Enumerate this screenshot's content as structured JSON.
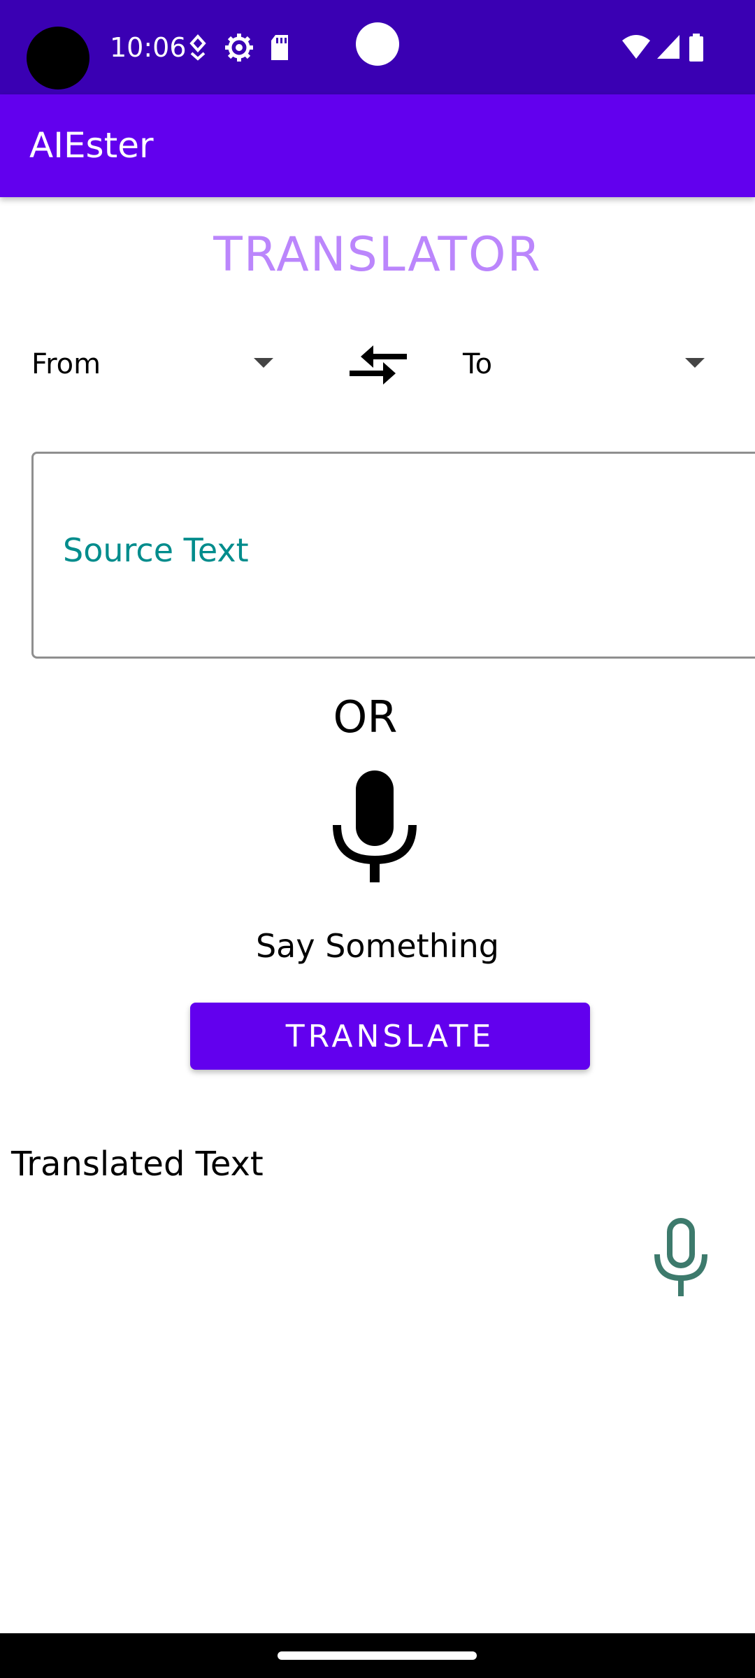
{
  "status_bar": {
    "time": "10:06",
    "icons": [
      "location-icon",
      "settings-gear-icon",
      "sd-card-icon",
      "wifi-icon",
      "signal-icon",
      "battery-icon"
    ]
  },
  "app_bar": {
    "title": "AIEster"
  },
  "main": {
    "heading": "TRANSLATOR",
    "from_spinner": {
      "selected": "From"
    },
    "to_spinner": {
      "selected": "To"
    },
    "source": {
      "value": "",
      "placeholder": "Source Text"
    },
    "or_label": "OR",
    "say_something": "Say Something",
    "translate_button": "TRANSLATE",
    "translated_label": "Translated Text"
  },
  "colors": {
    "status_bar": "#3a00b3",
    "app_bar": "#6200ee",
    "heading": "#bb86fc",
    "placeholder": "#008c8c",
    "small_mic": "#3d7a6c"
  }
}
